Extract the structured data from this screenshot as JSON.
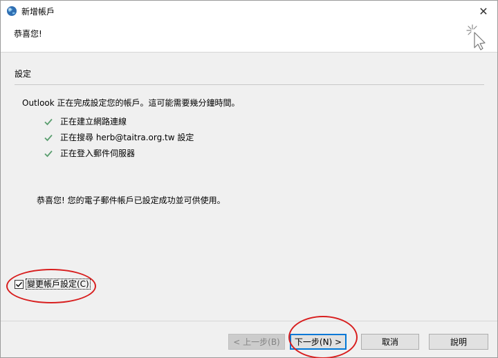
{
  "window": {
    "title": "新增帳戶",
    "close_glyph": "✕"
  },
  "header": {
    "title": "恭喜您!",
    "icon": "wizard-cursor-icon"
  },
  "section": {
    "title": "設定",
    "intro": "Outlook 正在完成設定您的帳戶。這可能需要幾分鐘時間。",
    "steps": [
      {
        "text": "正在建立網路連線",
        "status": "done"
      },
      {
        "text": "正在搜尋 herb@taitra.org.tw 設定",
        "status": "done"
      },
      {
        "text": "正在登入郵件伺服器",
        "status": "done"
      }
    ],
    "congrats": "恭喜您! 您的電子郵件帳戶已設定成功並可供使用。"
  },
  "change_settings": {
    "label": "變更帳戶設定(C)",
    "checked": true
  },
  "buttons": {
    "prev": "< 上一步(B)",
    "next": "下一步(N) >",
    "cancel": "取消",
    "help": "說明"
  },
  "colors": {
    "check_green": "#5a9e6f",
    "annotation_red": "#d81e1e",
    "default_button_border": "#0078d7"
  }
}
